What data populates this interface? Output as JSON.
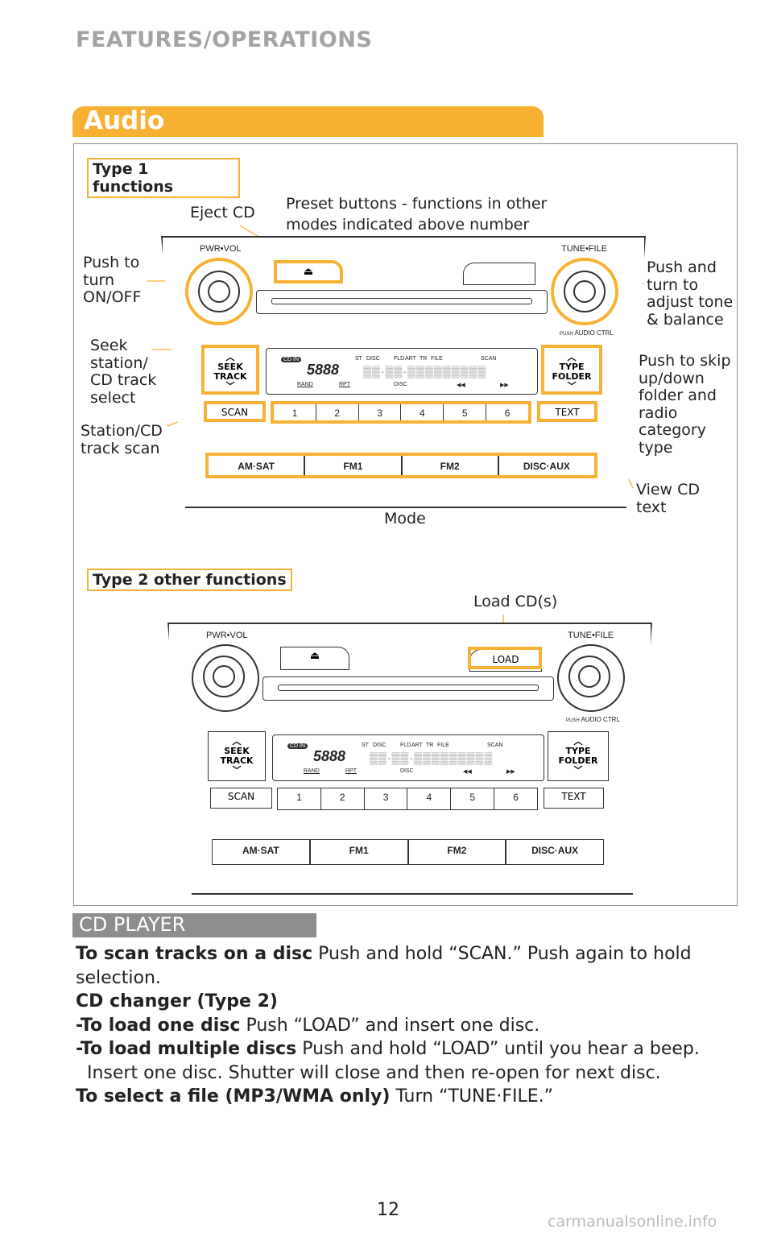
{
  "header": {
    "section": "FEATURES/OPERATIONS",
    "tab": "Audio"
  },
  "type1": {
    "title": "Type 1 functions",
    "callouts": {
      "eject": "Eject CD",
      "preset": [
        "Preset buttons - functions in other",
        "modes indicated above number"
      ],
      "power": [
        "Push to",
        "turn",
        "ON/OFF"
      ],
      "tune": [
        "Push and",
        "turn to",
        "adjust tone",
        "& balance"
      ],
      "seek": [
        "Seek",
        "station/",
        "CD track",
        "select"
      ],
      "scan": [
        "Station/CD",
        "track scan"
      ],
      "folder": [
        "Push to skip",
        "up/down",
        "folder and",
        "radio",
        "category",
        "type"
      ],
      "text": [
        "View CD",
        "text"
      ],
      "mode": "Mode"
    }
  },
  "type2": {
    "title": "Type 2 other functions",
    "callouts": {
      "load": "Load CD(s)"
    }
  },
  "radio": {
    "pwr_vol": "PWR•VOL",
    "tune_file": "TUNE•FILE",
    "push": "PUSH",
    "audio_ctrl": "AUDIO CTRL",
    "seek": "SEEK",
    "track": "TRACK",
    "type": "TYPE",
    "folder": "FOLDER",
    "scan": "SCAN",
    "text": "TEXT",
    "load": "LOAD",
    "presets": [
      "1",
      "2",
      "3",
      "4",
      "5",
      "6"
    ],
    "modes": [
      "AM·SAT",
      "FM1",
      "FM2",
      "DISC·AUX"
    ],
    "display": {
      "cd_in": "CD IN",
      "st": "ST",
      "disc": "DISC",
      "fld": "FLD",
      "art": "ART",
      "tr": "TR",
      "file": "FILE",
      "scan": "SCAN",
      "rand": "RAND",
      "rpt": "RPT",
      "disc2": "DISC"
    }
  },
  "cd_player": {
    "title": "CD PLAYER",
    "lines": [
      {
        "bold": "To scan tracks on a disc",
        "text": " Push and hold “SCAN.” Push again to hold"
      },
      {
        "bold": "",
        "text": "selection."
      },
      {
        "bold": "CD changer (Type 2)",
        "text": ""
      },
      {
        "bold": "-To load one disc",
        "text": " Push “LOAD” and insert one disc."
      },
      {
        "bold": "-To load multiple discs",
        "text": " Push and hold “LOAD” until you hear a beep."
      },
      {
        "bold": "",
        "text": "  Insert one disc. Shutter will close and then re-open for next disc."
      },
      {
        "bold": "To select a file (MP3/WMA only)",
        "text": " Turn “TUNE·FILE.”"
      }
    ]
  },
  "page_number": "12",
  "watermark": "carmanualsonline.info",
  "colors": {
    "accent": "#f8b133",
    "banner": "#8d8d8d"
  }
}
